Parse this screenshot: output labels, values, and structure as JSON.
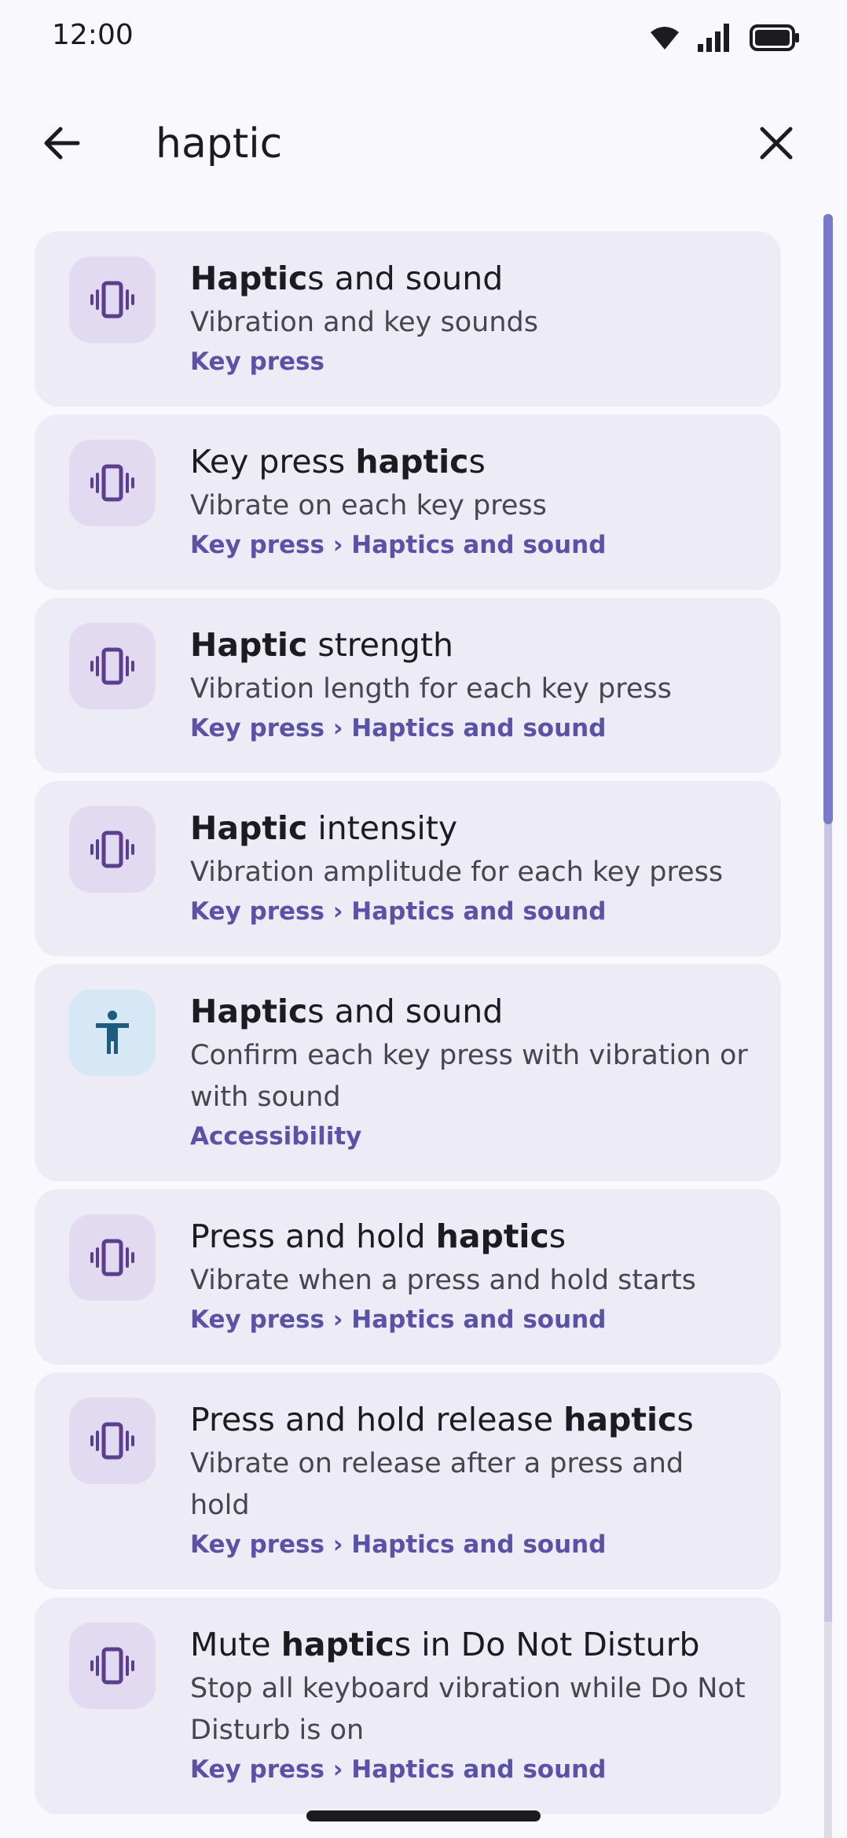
{
  "status": {
    "time": "12:00"
  },
  "search": {
    "query": "haptic"
  },
  "colors": {
    "accent": "#5b52a8",
    "card": "#edebf5",
    "icon_bg": "#e1daf0",
    "icon_fg": "#5a3f8f",
    "accessibility_bg": "#d6e8f6",
    "accessibility_fg": "#1d5c7c"
  },
  "results": [
    {
      "title_pre": "",
      "title_bold": "Haptic",
      "title_post": "s and sound",
      "summary": "Vibration and key sounds",
      "breadcrumb": "Key press",
      "icon": "vibration-icon"
    },
    {
      "title_pre": "Key press ",
      "title_bold": "haptic",
      "title_post": "s",
      "summary": "Vibrate on each key press",
      "breadcrumb": "Key press › Haptics and sound",
      "icon": "vibration-icon"
    },
    {
      "title_pre": "",
      "title_bold": "Haptic",
      "title_post": " strength",
      "summary": "Vibration length for each key press",
      "breadcrumb": "Key press › Haptics and sound",
      "icon": "vibration-icon"
    },
    {
      "title_pre": "",
      "title_bold": "Haptic",
      "title_post": " intensity",
      "summary": "Vibration amplitude for each key press",
      "breadcrumb": "Key press › Haptics and sound",
      "icon": "vibration-icon"
    },
    {
      "title_pre": "",
      "title_bold": "Haptic",
      "title_post": "s and sound",
      "summary": "Confirm each key press with vibration or with sound",
      "breadcrumb": "Accessibility",
      "icon": "accessibility-icon"
    },
    {
      "title_pre": "Press and hold ",
      "title_bold": "haptic",
      "title_post": "s",
      "summary": "Vibrate when a press and hold starts",
      "breadcrumb": "Key press › Haptics and sound",
      "icon": "vibration-icon"
    },
    {
      "title_pre": "Press and hold release ",
      "title_bold": "haptic",
      "title_post": "s",
      "summary": "Vibrate on release after a press and hold",
      "breadcrumb": "Key press › Haptics and sound",
      "icon": "vibration-icon"
    },
    {
      "title_pre": "Mute ",
      "title_bold": "haptic",
      "title_post": "s in Do Not Disturb",
      "summary": "Stop all keyboard vibration while Do Not Disturb is on",
      "breadcrumb": "Key press › Haptics and sound",
      "icon": "vibration-icon"
    }
  ]
}
